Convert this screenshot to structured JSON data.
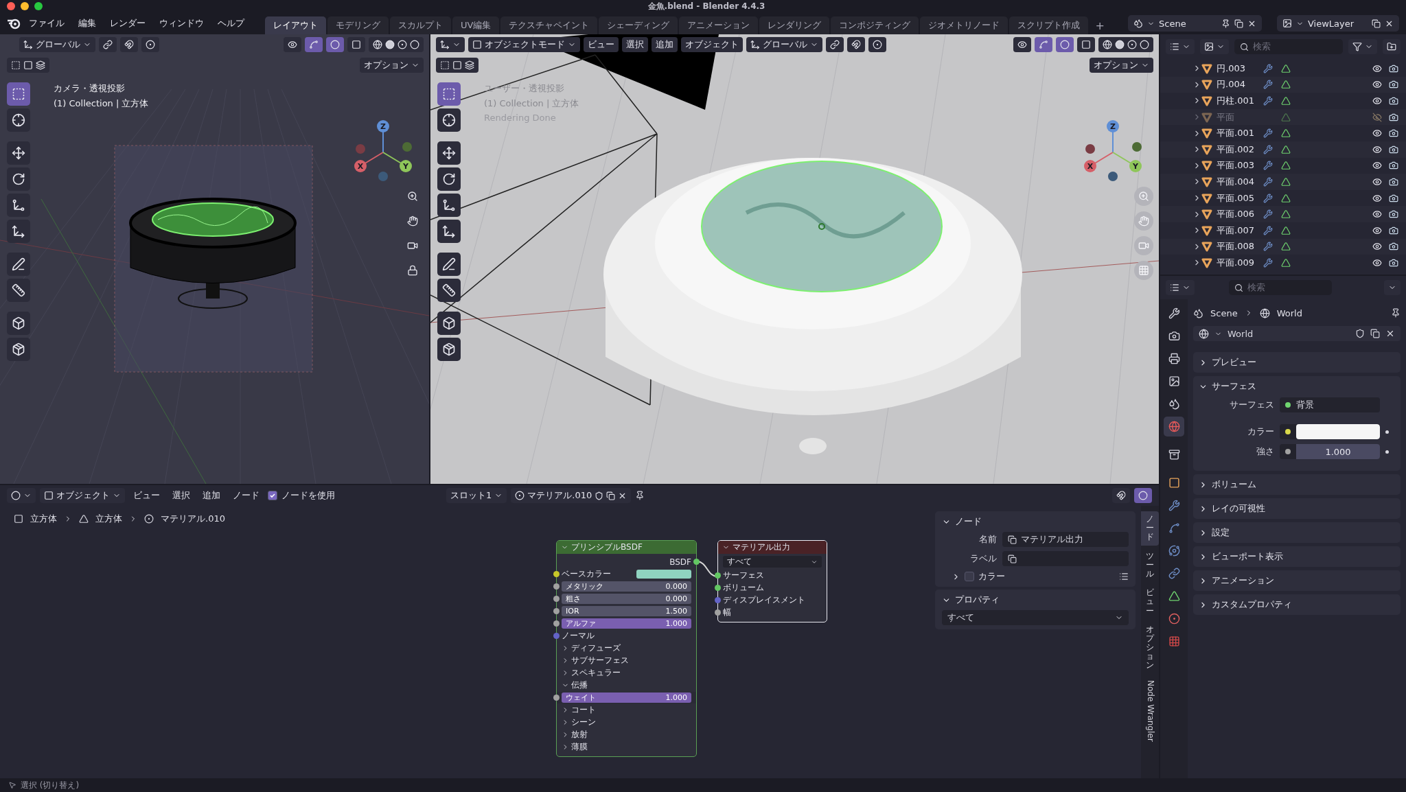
{
  "window": {
    "title": "金魚.blend - Blender 4.4.3"
  },
  "menu": [
    "ファイル",
    "編集",
    "レンダー",
    "ウィンドウ",
    "ヘルプ"
  ],
  "workspaces": [
    {
      "label": "レイアウト",
      "selected": true
    },
    {
      "label": "モデリング",
      "selected": false
    },
    {
      "label": "スカルプト",
      "selected": false
    },
    {
      "label": "UV編集",
      "selected": false
    },
    {
      "label": "テクスチャペイント",
      "selected": false
    },
    {
      "label": "シェーディング",
      "selected": false
    },
    {
      "label": "アニメーション",
      "selected": false
    },
    {
      "label": "レンダリング",
      "selected": false
    },
    {
      "label": "コンポジティング",
      "selected": false
    },
    {
      "label": "ジオメトリノード",
      "selected": false
    },
    {
      "label": "スクリプト作成",
      "selected": false
    }
  ],
  "add_workspace": "+",
  "scene": "Scene",
  "view_layer": "ViewLayer",
  "left_viewport": {
    "transform": "グローバル",
    "options": "オプション",
    "overlay": [
      "カメラ・透視投影",
      "(1) Collection | 立方体"
    ],
    "axes": [
      "X",
      "Y",
      "Z"
    ],
    "tools": [
      {
        "kind": "select",
        "selected": true
      },
      {
        "kind": "cursor",
        "selected": false
      },
      {
        "kind": "move",
        "selected": false
      },
      {
        "kind": "rotate",
        "selected": false
      },
      {
        "kind": "scale",
        "selected": false
      },
      {
        "kind": "transform",
        "selected": false
      },
      {
        "kind": "annotate",
        "selected": false
      },
      {
        "kind": "measure",
        "selected": false
      },
      {
        "kind": "add",
        "selected": false
      },
      {
        "kind": "extrude",
        "selected": false
      }
    ]
  },
  "main_viewport": {
    "mode": "オブジェクトモード",
    "menus": [
      "ビュー",
      "選択",
      "追加",
      "オブジェクト"
    ],
    "transform": "グローバル",
    "options": "オプション",
    "overlay": [
      "ユーザー・透視投影",
      "(1) Collection | 立方体",
      "Rendering Done"
    ],
    "axes": [
      "X",
      "Y",
      "Z"
    ],
    "tools": [
      {
        "kind": "select",
        "selected": true
      },
      {
        "kind": "cursor",
        "selected": false
      },
      {
        "kind": "move",
        "selected": false
      },
      {
        "kind": "rotate",
        "selected": false
      },
      {
        "kind": "scale",
        "selected": false
      },
      {
        "kind": "transform",
        "selected": false
      },
      {
        "kind": "annotate",
        "selected": false
      },
      {
        "kind": "measure",
        "selected": false
      },
      {
        "kind": "add",
        "selected": false
      },
      {
        "kind": "extrude",
        "selected": false
      }
    ]
  },
  "outliner": {
    "search_placeholder": "検索",
    "items": [
      {
        "name": "円.003",
        "modifier": true,
        "hidden": false
      },
      {
        "name": "円.004",
        "modifier": true,
        "hidden": false
      },
      {
        "name": "円柱.001",
        "modifier": true,
        "hidden": false
      },
      {
        "name": "平面",
        "modifier": false,
        "hidden": true
      },
      {
        "name": "平面.001",
        "modifier": true,
        "hidden": false
      },
      {
        "name": "平面.002",
        "modifier": true,
        "hidden": false
      },
      {
        "name": "平面.003",
        "modifier": true,
        "hidden": false
      },
      {
        "name": "平面.004",
        "modifier": true,
        "hidden": false
      },
      {
        "name": "平面.005",
        "modifier": true,
        "hidden": false
      },
      {
        "name": "平面.006",
        "modifier": true,
        "hidden": false
      },
      {
        "name": "平面.007",
        "modifier": true,
        "hidden": false
      },
      {
        "name": "平面.008",
        "modifier": true,
        "hidden": false
      },
      {
        "name": "平面.009",
        "modifier": true,
        "hidden": false
      }
    ]
  },
  "properties": {
    "search_placeholder": "検索",
    "breadcrumb": [
      "Scene",
      "World"
    ],
    "world": "World",
    "tabs": [
      {
        "kind": "tool",
        "selected": false
      },
      {
        "kind": "render",
        "selected": false
      },
      {
        "kind": "output",
        "selected": false
      },
      {
        "kind": "view_layer",
        "selected": false
      },
      {
        "kind": "scene",
        "selected": false
      },
      {
        "kind": "world",
        "selected": true
      },
      {
        "kind": "collection",
        "selected": false
      },
      {
        "kind": "object",
        "selected": false
      },
      {
        "kind": "modifier",
        "selected": false
      },
      {
        "kind": "particles",
        "selected": false
      },
      {
        "kind": "physics",
        "selected": false
      },
      {
        "kind": "constraints",
        "selected": false
      },
      {
        "kind": "data",
        "selected": false
      },
      {
        "kind": "material",
        "selected": false
      },
      {
        "kind": "texture",
        "selected": false
      }
    ],
    "panels": [
      {
        "label": "プレビュー",
        "expanded": false
      },
      {
        "label": "サーフェス",
        "expanded": true,
        "fields": [
          {
            "kind": "shader",
            "label": "サーフェス",
            "value": "背景"
          },
          {
            "kind": "color",
            "label": "カラー"
          },
          {
            "kind": "value",
            "label": "強さ",
            "value": "1.000"
          }
        ]
      },
      {
        "label": "ボリューム",
        "expanded": false
      },
      {
        "label": "レイの可視性",
        "expanded": false
      },
      {
        "label": "設定",
        "expanded": false
      },
      {
        "label": "ビューポート表示",
        "expanded": false
      },
      {
        "label": "アニメーション",
        "expanded": false
      },
      {
        "label": "カスタムプロパティ",
        "expanded": false
      }
    ]
  },
  "node_editor": {
    "object_mode": "オブジェクト",
    "menus": [
      "ビュー",
      "選択",
      "追加",
      "ノード"
    ],
    "use_nodes": {
      "label": "ノードを使用",
      "checked": true
    },
    "slot": "スロット1",
    "material": "マテリアル.010",
    "breadcrumb": [
      "立方体",
      "立方体",
      "マテリアル.010"
    ],
    "nodes": [
      {
        "kind": "shader",
        "title": "プリンシプルBSDF",
        "selected": false,
        "rows": [
          {
            "kind": "output",
            "label": "BSDF",
            "color": "#63c763"
          },
          {
            "kind": "color",
            "label": "ベースカラー",
            "color": "#c7c729"
          },
          {
            "kind": "value",
            "label": "メタリック",
            "value": "0.000",
            "color": "#a1a1a1"
          },
          {
            "kind": "value",
            "label": "粗さ",
            "value": "0.000",
            "color": "#a1a1a1"
          },
          {
            "kind": "value",
            "label": "IOR",
            "value": "1.500",
            "color": "#a1a1a1"
          },
          {
            "kind": "factor",
            "label": "アルファ",
            "value": "1.000",
            "color": "#a1a1a1"
          },
          {
            "kind": "input",
            "label": "ノーマル",
            "color": "#6363c7"
          },
          {
            "kind": "panel",
            "label": "ディフューズ",
            "expanded": false
          },
          {
            "kind": "panel",
            "label": "サブサーフェス",
            "expanded": false
          },
          {
            "kind": "panel",
            "label": "スペキュラー",
            "expanded": false
          },
          {
            "kind": "panel",
            "label": "伝播",
            "expanded": true,
            "children": [
              {
                "kind": "factor",
                "label": "ウェイト",
                "value": "1.000",
                "color": "#a1a1a1"
              }
            ]
          },
          {
            "kind": "panel",
            "label": "コート",
            "expanded": false
          },
          {
            "kind": "panel",
            "label": "シーン",
            "expanded": false
          },
          {
            "kind": "panel",
            "label": "放射",
            "expanded": false
          },
          {
            "kind": "panel",
            "label": "薄膜",
            "expanded": false
          }
        ]
      },
      {
        "kind": "output",
        "title": "マテリアル出力",
        "selected": true,
        "target": "すべて",
        "rows": [
          {
            "kind": "input",
            "label": "サーフェス",
            "color": "#63c763"
          },
          {
            "kind": "input",
            "label": "ボリューム",
            "color": "#63c763"
          },
          {
            "kind": "input",
            "label": "ディスプレイスメント",
            "color": "#6363c7"
          },
          {
            "kind": "input",
            "label": "幅",
            "color": "#a1a1a1"
          }
        ]
      }
    ],
    "sidebar": {
      "node_section": {
        "label": "ノード",
        "expanded": true
      },
      "name_label": "名前",
      "name_value": "マテリアル出力",
      "label_label": "ラベル",
      "color": {
        "label": "カラー",
        "checked": false,
        "expanded": false
      },
      "properties_section": {
        "label": "プロパティ",
        "expanded": true
      },
      "properties_value": "すべて"
    },
    "tabs": [
      {
        "label": "ノード",
        "kind": "stacked",
        "selected": true
      },
      {
        "label": "ツール",
        "kind": "stacked",
        "selected": false
      },
      {
        "label": "ビュー",
        "kind": "stacked",
        "selected": false
      },
      {
        "label": "オプション",
        "kind": "stacked",
        "selected": false
      },
      {
        "label": "Node Wrangler",
        "kind": "rotated",
        "selected": false
      }
    ]
  },
  "status_bar": {
    "hint": "選択 (切り替え)"
  }
}
